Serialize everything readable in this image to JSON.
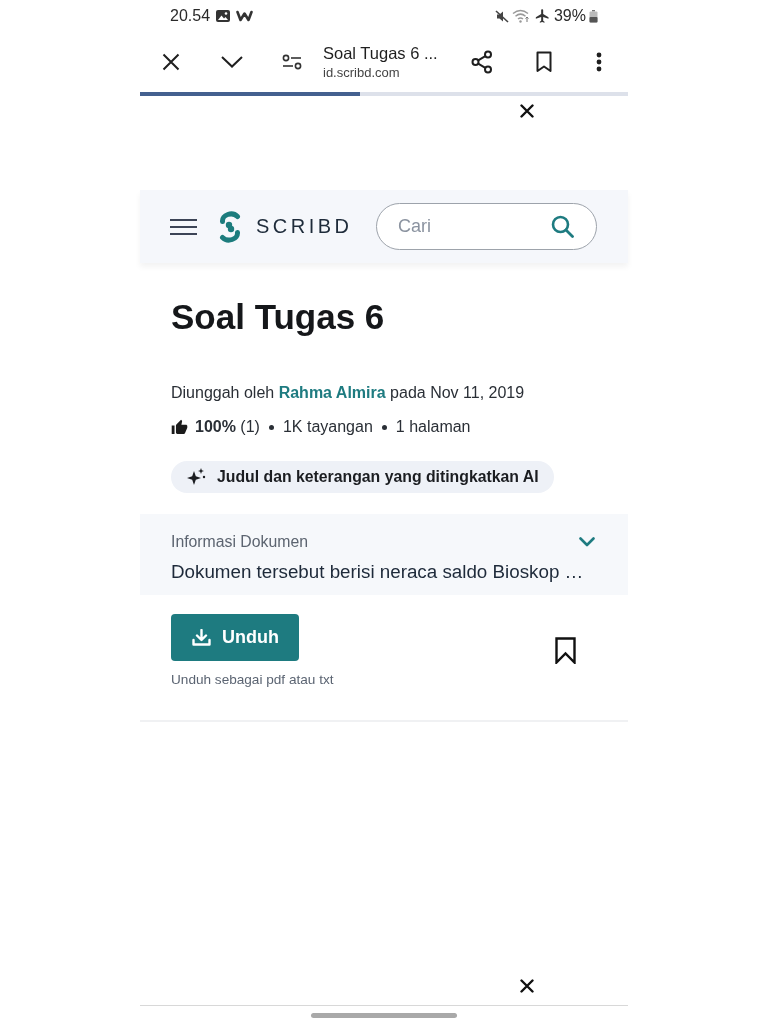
{
  "status_bar": {
    "time": "20.54",
    "battery": "39%"
  },
  "browser_toolbar": {
    "title": "Soal Tugas 6 ...",
    "url": "id.scribd.com",
    "progress": {
      "level": 0.45
    }
  },
  "site_header": {
    "logo": "SCRIBD",
    "search": {
      "placeholder": "Cari"
    }
  },
  "document": {
    "title": "Soal Tugas 6",
    "upload": {
      "prefix": "Diunggah oleh",
      "author": "Rahma Almira",
      "suffix": "pada Nov 11, 2019"
    },
    "stats": [
      "**100%** (1)",
      "1K tayangan",
      "1 halaman"
    ],
    "ai_badge": "Judul dan keterangan yang ditingkatkan AI"
  },
  "info_panel": {
    "label": "Informasi Dokumen",
    "description": "Dokumen tersebut berisi neraca saldo Bioskop …",
    "expanded": false
  },
  "download": {
    "button": "Unduh",
    "note": "Unduh sebagai pdf atau txt"
  }
}
